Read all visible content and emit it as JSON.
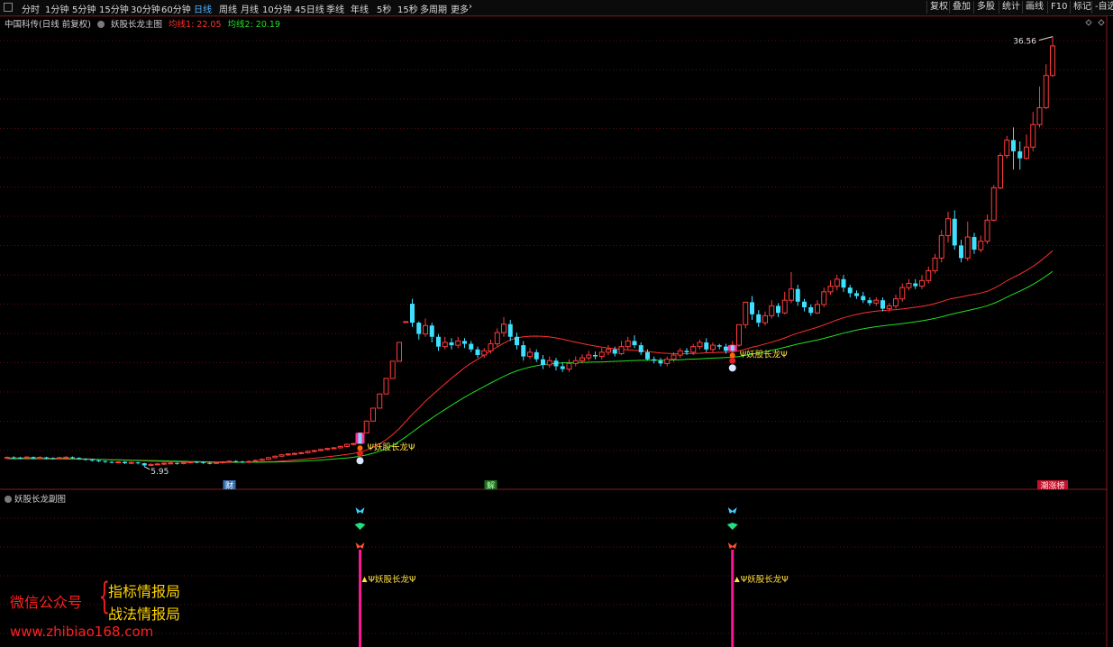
{
  "toolbar": {
    "timeframes": [
      "分时",
      "1分钟",
      "5分钟",
      "15分钟",
      "30分钟",
      "60分钟",
      "日线",
      "周线",
      "月线",
      "10分钟",
      "45日线",
      "季线",
      "年线",
      "5秒",
      "15秒",
      "多周期",
      "更多"
    ],
    "active": "日线",
    "right_buttons": [
      "复权",
      "叠加",
      "多股",
      "统计",
      "画线",
      "F10",
      "标记",
      "-自选"
    ],
    "icons": [
      "menu-icon",
      "chevron-right-icon"
    ]
  },
  "main_panel": {
    "stock_title": "中国科传(日线 前复权)",
    "indicator_name": "妖股长龙主图",
    "ma1_label": "均线1: 22.05",
    "ma2_label": "均线2: 20.19",
    "colors": {
      "ma1": "#ff3030",
      "ma2": "#20e020",
      "up": "#ff3b3b",
      "down": "#3fe0ff",
      "signal_text": "#ffe040"
    }
  },
  "sub_panel": {
    "name": "妖股长龙副图"
  },
  "events": {
    "cai": "财",
    "jie": "解",
    "yuan": "潮涨榜"
  },
  "signal_label": "Ψ妖股长龙Ψ",
  "watermark": {
    "left": "微信公众号",
    "line1": "指标情报局",
    "line2": "战法情报局",
    "url": "www.zhibiao168.com"
  },
  "chart_data": {
    "type": "candlestick",
    "title": "中国科传(日线 前复权)",
    "annotations": {
      "high_label": "36.56",
      "low_label": "5.95"
    },
    "candles": [
      [
        6.55,
        6.62,
        6.68,
        6.49
      ],
      [
        6.62,
        6.6,
        6.7,
        6.52
      ],
      [
        6.6,
        6.58,
        6.66,
        6.5
      ],
      [
        6.58,
        6.64,
        6.7,
        6.52
      ],
      [
        6.64,
        6.55,
        6.68,
        6.48
      ],
      [
        6.55,
        6.62,
        6.7,
        6.5
      ],
      [
        6.62,
        6.56,
        6.66,
        6.48
      ],
      [
        6.56,
        6.54,
        6.62,
        6.46
      ],
      [
        6.54,
        6.6,
        6.66,
        6.48
      ],
      [
        6.6,
        6.63,
        6.7,
        6.52
      ],
      [
        6.63,
        6.58,
        6.68,
        6.52
      ],
      [
        6.58,
        6.52,
        6.63,
        6.45
      ],
      [
        6.52,
        6.45,
        6.56,
        6.38
      ],
      [
        6.45,
        6.4,
        6.5,
        6.32
      ],
      [
        6.4,
        6.36,
        6.44,
        6.28
      ],
      [
        6.36,
        6.3,
        6.4,
        6.22
      ],
      [
        6.3,
        6.28,
        6.36,
        6.2
      ],
      [
        6.28,
        6.3,
        6.36,
        6.22
      ],
      [
        6.3,
        6.2,
        6.34,
        6.14
      ],
      [
        6.2,
        6.26,
        6.32,
        6.14
      ],
      [
        6.26,
        6.2,
        6.3,
        6.12
      ],
      [
        6.2,
        6.05,
        6.24,
        5.95
      ],
      [
        6.05,
        6.12,
        6.18,
        6.0
      ],
      [
        6.12,
        6.15,
        6.22,
        6.05
      ],
      [
        6.15,
        6.2,
        6.26,
        6.08
      ],
      [
        6.2,
        6.22,
        6.28,
        6.12
      ],
      [
        6.22,
        6.18,
        6.26,
        6.1
      ],
      [
        6.18,
        6.25,
        6.32,
        6.12
      ],
      [
        6.25,
        6.3,
        6.36,
        6.18
      ],
      [
        6.3,
        6.28,
        6.36,
        6.2
      ],
      [
        6.28,
        6.22,
        6.34,
        6.16
      ],
      [
        6.22,
        6.2,
        6.28,
        6.12
      ],
      [
        6.2,
        6.25,
        6.3,
        6.14
      ],
      [
        6.25,
        6.3,
        6.36,
        6.18
      ],
      [
        6.3,
        6.35,
        6.4,
        6.24
      ],
      [
        6.35,
        6.32,
        6.42,
        6.26
      ],
      [
        6.32,
        6.28,
        6.38,
        6.22
      ],
      [
        6.28,
        6.33,
        6.4,
        6.22
      ],
      [
        6.33,
        6.4,
        6.46,
        6.26
      ],
      [
        6.4,
        6.48,
        6.55,
        6.34
      ],
      [
        6.48,
        6.6,
        6.66,
        6.42
      ],
      [
        6.6,
        6.7,
        6.76,
        6.54
      ],
      [
        6.7,
        6.8,
        6.85,
        6.64
      ],
      [
        6.8,
        6.86,
        6.92,
        6.72
      ],
      [
        6.86,
        6.9,
        6.96,
        6.78
      ],
      [
        6.9,
        6.95,
        7.02,
        6.84
      ],
      [
        6.95,
        7.05,
        7.1,
        6.88
      ],
      [
        7.05,
        7.1,
        7.16,
        6.98
      ],
      [
        7.1,
        7.18,
        7.24,
        7.04
      ],
      [
        7.18,
        7.25,
        7.3,
        7.12
      ],
      [
        7.25,
        7.3,
        7.36,
        7.18
      ],
      [
        7.3,
        7.4,
        7.46,
        7.24
      ],
      [
        7.4,
        7.55,
        7.6,
        7.34
      ],
      [
        7.55,
        7.6,
        7.66,
        7.48
      ],
      [
        7.6,
        8.36,
        8.4,
        7.58
      ],
      [
        8.36,
        9.2,
        9.25,
        8.36
      ],
      [
        9.2,
        10.12,
        10.15,
        9.2
      ],
      [
        10.12,
        11.13,
        11.16,
        10.12
      ],
      [
        11.13,
        12.24,
        12.26,
        11.13
      ],
      [
        12.24,
        13.46,
        13.48,
        12.24
      ],
      [
        13.46,
        14.8,
        14.82,
        13.46
      ],
      [
        16.28,
        16.28,
        16.3,
        16.26
      ],
      [
        17.55,
        16.2,
        17.9,
        15.9
      ],
      [
        16.2,
        15.4,
        16.3,
        15.0
      ],
      [
        15.4,
        16.0,
        16.5,
        15.2
      ],
      [
        16.0,
        15.2,
        16.2,
        14.8
      ],
      [
        15.2,
        14.5,
        15.4,
        14.2
      ],
      [
        14.5,
        14.8,
        15.2,
        14.3
      ],
      [
        14.8,
        14.6,
        15.1,
        14.3
      ],
      [
        14.6,
        14.9,
        15.2,
        14.4
      ],
      [
        14.9,
        14.7,
        15.1,
        14.4
      ],
      [
        14.7,
        14.3,
        14.9,
        14.1
      ],
      [
        14.3,
        13.9,
        14.5,
        13.7
      ],
      [
        13.9,
        14.2,
        14.4,
        13.7
      ],
      [
        14.2,
        14.7,
        15.0,
        14.0
      ],
      [
        14.7,
        15.5,
        15.8,
        14.5
      ],
      [
        15.5,
        16.1,
        16.6,
        15.2
      ],
      [
        16.1,
        15.2,
        16.4,
        14.9
      ],
      [
        15.2,
        14.6,
        15.5,
        14.3
      ],
      [
        14.6,
        13.8,
        14.9,
        13.5
      ],
      [
        13.8,
        14.1,
        14.4,
        13.6
      ],
      [
        14.1,
        13.6,
        14.3,
        13.4
      ],
      [
        13.6,
        13.2,
        13.9,
        12.9
      ],
      [
        13.2,
        13.5,
        13.8,
        13.0
      ],
      [
        13.5,
        13.1,
        13.7,
        12.8
      ],
      [
        13.1,
        12.9,
        13.4,
        12.7
      ],
      [
        12.9,
        13.3,
        13.6,
        12.7
      ],
      [
        13.3,
        13.5,
        13.8,
        13.1
      ],
      [
        13.5,
        13.7,
        13.95,
        13.3
      ],
      [
        13.7,
        13.9,
        14.2,
        13.5
      ],
      [
        13.9,
        13.8,
        14.15,
        13.6
      ],
      [
        13.8,
        14.1,
        14.4,
        13.6
      ],
      [
        14.1,
        14.3,
        14.6,
        13.9
      ],
      [
        14.3,
        14.0,
        14.5,
        13.8
      ],
      [
        14.0,
        14.5,
        14.9,
        13.9
      ],
      [
        14.5,
        14.9,
        15.2,
        14.3
      ],
      [
        14.9,
        14.6,
        15.3,
        14.4
      ],
      [
        14.6,
        14.1,
        14.8,
        13.9
      ],
      [
        14.1,
        13.6,
        14.3,
        13.5
      ],
      [
        13.6,
        13.5,
        13.8,
        13.3
      ],
      [
        13.5,
        13.3,
        13.7,
        13.1
      ],
      [
        13.3,
        13.6,
        13.8,
        13.1
      ],
      [
        13.6,
        13.9,
        14.1,
        13.4
      ],
      [
        13.9,
        14.2,
        14.4,
        13.7
      ],
      [
        14.2,
        14.1,
        14.4,
        13.9
      ],
      [
        14.1,
        14.5,
        14.7,
        13.9
      ],
      [
        14.5,
        14.8,
        15.0,
        14.3
      ],
      [
        14.8,
        14.3,
        15.1,
        14.1
      ],
      [
        14.3,
        14.6,
        14.8,
        14.1
      ],
      [
        14.6,
        14.5,
        14.7,
        14.3
      ],
      [
        14.5,
        14.2,
        14.7,
        14.0
      ],
      [
        14.2,
        14.6,
        14.9,
        14.0
      ],
      [
        14.6,
        16.06,
        16.06,
        14.5
      ],
      [
        16.06,
        17.66,
        17.7,
        15.8
      ],
      [
        17.66,
        16.8,
        18.1,
        16.4
      ],
      [
        16.8,
        16.2,
        17.1,
        15.9
      ],
      [
        16.2,
        16.7,
        17.0,
        16.0
      ],
      [
        16.7,
        17.4,
        17.8,
        16.5
      ],
      [
        17.4,
        16.9,
        17.6,
        16.6
      ],
      [
        16.9,
        17.8,
        18.4,
        16.8
      ],
      [
        17.8,
        18.6,
        19.8,
        17.6
      ],
      [
        18.6,
        17.7,
        18.9,
        17.4
      ],
      [
        17.7,
        17.3,
        17.9,
        17.0
      ],
      [
        17.3,
        16.9,
        17.5,
        16.7
      ],
      [
        16.9,
        17.5,
        17.8,
        16.8
      ],
      [
        17.5,
        18.4,
        18.7,
        17.3
      ],
      [
        18.4,
        18.8,
        19.2,
        18.2
      ],
      [
        18.8,
        19.3,
        19.6,
        18.5
      ],
      [
        19.3,
        18.7,
        19.6,
        18.4
      ],
      [
        18.7,
        18.3,
        18.9,
        18.0
      ],
      [
        18.3,
        18.1,
        18.5,
        17.9
      ],
      [
        18.1,
        17.8,
        18.4,
        17.6
      ],
      [
        17.8,
        17.6,
        18.0,
        17.4
      ],
      [
        17.6,
        17.8,
        18.0,
        17.4
      ],
      [
        17.8,
        17.2,
        18.0,
        17.0
      ],
      [
        17.2,
        17.4,
        17.6,
        17.0
      ],
      [
        17.4,
        17.9,
        18.2,
        17.2
      ],
      [
        17.9,
        18.7,
        19.0,
        17.7
      ],
      [
        18.7,
        19.0,
        19.3,
        18.5
      ],
      [
        19.0,
        18.8,
        19.3,
        18.6
      ],
      [
        18.8,
        19.2,
        19.6,
        18.6
      ],
      [
        19.2,
        19.9,
        20.2,
        19.0
      ],
      [
        19.9,
        20.8,
        21.1,
        19.7
      ],
      [
        20.8,
        22.4,
        22.8,
        20.5
      ],
      [
        22.4,
        23.6,
        24.1,
        21.9
      ],
      [
        23.6,
        21.7,
        24.2,
        21.4
      ],
      [
        21.7,
        20.8,
        22.1,
        20.5
      ],
      [
        20.8,
        22.3,
        23.4,
        20.6
      ],
      [
        22.3,
        21.4,
        22.6,
        21.1
      ],
      [
        21.4,
        22.0,
        22.4,
        21.2
      ],
      [
        22.0,
        23.5,
        23.9,
        21.8
      ],
      [
        23.5,
        25.8,
        26.0,
        23.4
      ],
      [
        25.8,
        28.1,
        28.3,
        25.7
      ],
      [
        28.1,
        29.2,
        29.5,
        27.9
      ],
      [
        29.2,
        28.4,
        30.1,
        27.1
      ],
      [
        28.4,
        27.9,
        29.1,
        27.1
      ],
      [
        27.9,
        28.7,
        29.6,
        27.8
      ],
      [
        28.7,
        30.3,
        31.2,
        28.4
      ],
      [
        30.3,
        31.5,
        33.0,
        30.1
      ],
      [
        31.5,
        33.8,
        34.6,
        31.4
      ],
      [
        33.8,
        35.9,
        36.56,
        33.7
      ]
    ],
    "ma1": [
      6.58,
      6.58,
      6.58,
      6.58,
      6.57,
      6.57,
      6.56,
      6.55,
      6.55,
      6.54,
      6.53,
      6.52,
      6.51,
      6.5,
      6.48,
      6.47,
      6.45,
      6.44,
      6.42,
      6.41,
      6.39,
      6.37,
      6.35,
      6.34,
      6.33,
      6.32,
      6.31,
      6.3,
      6.29,
      6.29,
      6.28,
      6.27,
      6.26,
      6.26,
      6.26,
      6.26,
      6.27,
      6.27,
      6.28,
      6.29,
      6.31,
      6.33,
      6.36,
      6.4,
      6.43,
      6.47,
      6.52,
      6.56,
      6.61,
      6.66,
      6.71,
      6.77,
      6.83,
      6.9,
      7.0,
      7.15,
      7.34,
      7.58,
      7.88,
      8.24,
      8.67,
      9.17,
      9.68,
      10.13,
      10.62,
      11.04,
      11.45,
      11.85,
      12.25,
      12.63,
      13.0,
      13.32,
      13.6,
      13.9,
      14.2,
      14.48,
      14.75,
      14.98,
      15.12,
      15.2,
      15.24,
      15.25,
      15.23,
      15.19,
      15.12,
      15.03,
      14.92,
      14.82,
      14.72,
      14.62,
      14.54,
      14.46,
      14.4,
      14.35,
      14.31,
      14.27,
      14.24,
      14.2,
      14.15,
      14.1,
      14.05,
      14.02,
      14.0,
      14.0,
      14.0,
      14.01,
      14.03,
      14.06,
      14.07,
      14.09,
      14.1,
      14.12,
      14.2,
      14.32,
      14.45,
      14.56,
      14.69,
      14.82,
      14.96,
      15.12,
      15.3,
      15.46,
      15.6,
      15.74,
      15.88,
      16.04,
      16.22,
      16.4,
      16.55,
      16.68,
      16.79,
      16.89,
      16.96,
      17.03,
      17.07,
      17.1,
      17.13,
      17.18,
      17.24,
      17.3,
      17.37,
      17.45,
      17.56,
      17.7,
      17.86,
      17.96,
      18.04,
      18.14,
      18.22,
      18.31,
      18.44,
      18.64,
      18.9,
      19.19,
      19.43,
      19.66,
      19.92,
      20.22,
      20.55,
      20.92,
      21.33
    ],
    "ma2": [
      6.52,
      6.52,
      6.52,
      6.52,
      6.52,
      6.52,
      6.51,
      6.51,
      6.51,
      6.5,
      6.5,
      6.49,
      6.49,
      6.48,
      6.47,
      6.46,
      6.45,
      6.44,
      6.43,
      6.42,
      6.41,
      6.4,
      6.39,
      6.38,
      6.37,
      6.36,
      6.35,
      6.34,
      6.33,
      6.32,
      6.31,
      6.3,
      6.29,
      6.28,
      6.28,
      6.27,
      6.27,
      6.27,
      6.27,
      6.27,
      6.28,
      6.29,
      6.3,
      6.31,
      6.33,
      6.35,
      6.37,
      6.4,
      6.43,
      6.46,
      6.5,
      6.54,
      6.58,
      6.63,
      6.7,
      6.79,
      6.91,
      7.06,
      7.25,
      7.48,
      7.76,
      8.08,
      8.42,
      8.76,
      9.1,
      9.42,
      9.73,
      10.03,
      10.33,
      10.62,
      10.9,
      11.16,
      11.41,
      11.66,
      11.91,
      12.15,
      12.38,
      12.6,
      12.78,
      12.92,
      13.04,
      13.14,
      13.22,
      13.28,
      13.32,
      13.35,
      13.36,
      13.37,
      13.38,
      13.39,
      13.4,
      13.41,
      13.43,
      13.45,
      13.47,
      13.49,
      13.51,
      13.52,
      13.53,
      13.53,
      13.53,
      13.54,
      13.55,
      13.57,
      13.59,
      13.61,
      13.63,
      13.66,
      13.68,
      13.7,
      13.72,
      13.74,
      13.8,
      13.88,
      13.97,
      14.05,
      14.14,
      14.24,
      14.34,
      14.45,
      14.57,
      14.68,
      14.78,
      14.88,
      14.98,
      15.09,
      15.21,
      15.34,
      15.46,
      15.57,
      15.68,
      15.77,
      15.85,
      15.92,
      15.98,
      16.03,
      16.08,
      16.14,
      16.2,
      16.27,
      16.34,
      16.42,
      16.51,
      16.62,
      16.75,
      16.86,
      16.96,
      17.07,
      17.17,
      17.28,
      17.41,
      17.58,
      17.79,
      18.02,
      18.24,
      18.45,
      18.68,
      18.93,
      19.21,
      19.52,
      19.86
    ],
    "signal_bars": [
      54,
      111
    ],
    "events": [
      {
        "label": "财",
        "bar": 34
      },
      {
        "label": "解",
        "bar": 74
      },
      {
        "label": "潮涨榜",
        "bar": 160
      }
    ]
  }
}
